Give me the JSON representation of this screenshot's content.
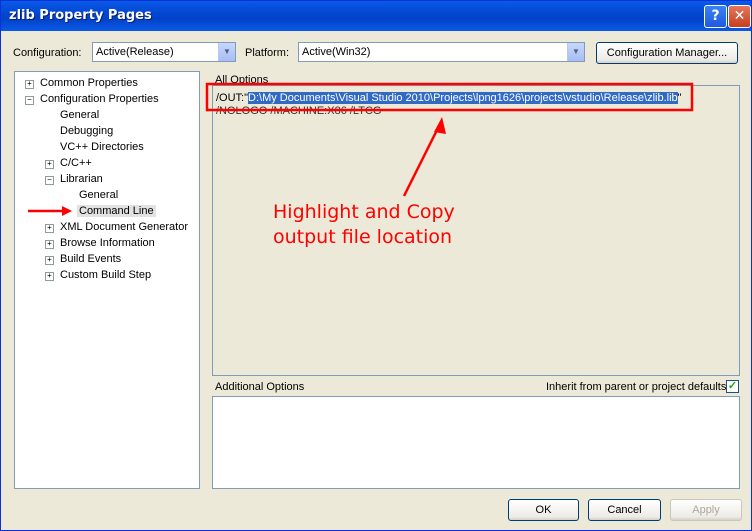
{
  "window": {
    "title": "zlib Property Pages"
  },
  "titlebar": {
    "help": "?",
    "close": "✕"
  },
  "config": {
    "label": "Configuration:",
    "value": "Active(Release)"
  },
  "platform": {
    "label": "Platform:",
    "value": "Active(Win32)"
  },
  "config_manager": "Configuration Manager...",
  "tree": {
    "common": "Common Properties",
    "config_props": "Configuration Properties",
    "general": "General",
    "debugging": "Debugging",
    "vc_dirs": "VC++ Directories",
    "cpp": "C/C++",
    "librarian": "Librarian",
    "lib_general": "General",
    "command_line": "Command Line",
    "xml_doc": "XML Document Generator",
    "browse": "Browse Information",
    "build_events": "Build Events",
    "custom_build": "Custom Build Step"
  },
  "all_options": {
    "label": "All Options",
    "line1_prefix": "/OUT:\"",
    "line1_path": "D:\\My Documents\\Visual Studio 2010\\Projects\\lpng1626\\projects\\vstudio\\Release\\zlib.lib",
    "line1_suffix": "\"",
    "line2": "/NOLOGO /MACHINE:X86 /LTCG"
  },
  "additional": {
    "label": "Additional Options",
    "inherit": "Inherit from parent or project defaults"
  },
  "buttons": {
    "ok": "OK",
    "cancel": "Cancel",
    "apply": "Apply"
  },
  "annotation": {
    "line1": "Highlight and Copy",
    "line2": "output file location"
  },
  "colors": {
    "annotation": "#ff0000",
    "highlight": "#316ac5",
    "titlebar": "#0348d1"
  }
}
